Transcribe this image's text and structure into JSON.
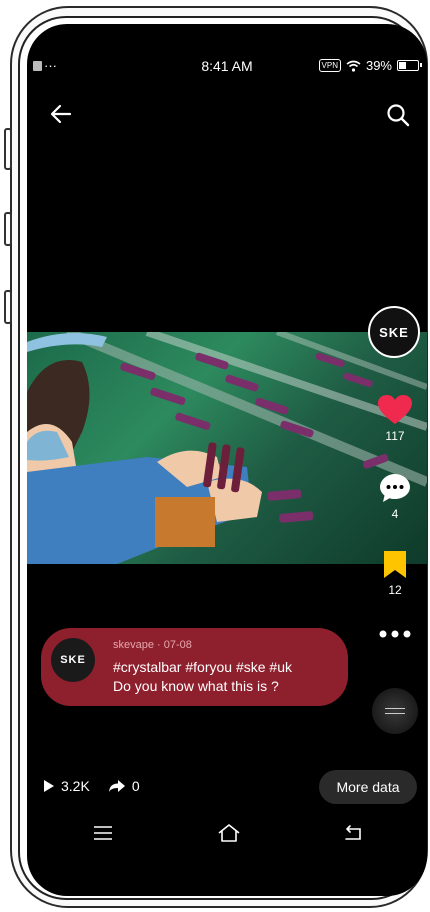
{
  "status_bar": {
    "left_text": "···",
    "time": "8:41 AM",
    "vpn": "VPN",
    "battery": "39%",
    "battery_level": 0.39
  },
  "header": {
    "back_icon": "arrow-left-icon",
    "search_icon": "search-icon"
  },
  "rail": {
    "avatar_logo": "SKE",
    "likes": "117",
    "comments": "4",
    "saves": "12",
    "more_icon": "more-dots-icon",
    "like_color": "#f0294e",
    "save_color": "#ffc400"
  },
  "caption": {
    "author_date": "skevape · 07-08",
    "hashtags": "#crystalbar #foryou #ske #uk",
    "text": "Do you know what this is ?",
    "bubble_color": "#8e1f2c"
  },
  "stats": {
    "plays": "3.2K",
    "shares": "0",
    "more_button": "More data"
  },
  "navbar": {
    "menu_icon": "menu-icon",
    "home_icon": "home-icon",
    "back_icon": "return-icon"
  }
}
